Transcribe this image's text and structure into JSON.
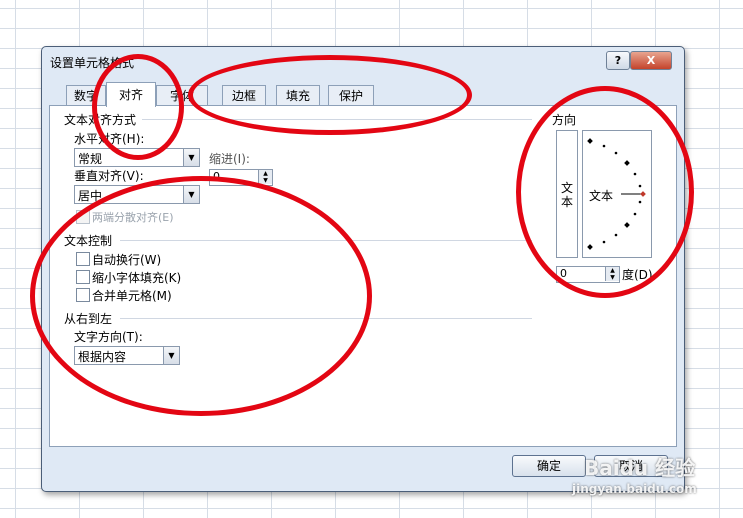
{
  "dialog": {
    "title": "设置单元格格式",
    "help": "?",
    "close": "X"
  },
  "tabs": [
    "数字",
    "对齐",
    "字体",
    "边框",
    "填充",
    "保护"
  ],
  "alignment": {
    "section_title": "文本对齐方式",
    "horizontal_label": "水平对齐(H):",
    "horizontal_value": "常规",
    "indent_label": "缩进(I):",
    "indent_value": "0",
    "vertical_label": "垂直对齐(V):",
    "vertical_value": "居中",
    "justify_distributed": "两端分散对齐(E)"
  },
  "text_control": {
    "section_title": "文本控制",
    "wrap": "自动换行(W)",
    "shrink": "缩小字体填充(K)",
    "merge": "合并单元格(M)"
  },
  "rtl": {
    "section_title": "从右到左",
    "direction_label": "文字方向(T):",
    "direction_value": "根据内容"
  },
  "orientation": {
    "section_title": "方向",
    "vertical_text": "文本",
    "horizontal_text": "文本",
    "degrees_value": "0",
    "degrees_label": "度(D)"
  },
  "buttons": {
    "ok": "确定",
    "cancel": "取消"
  },
  "watermark": {
    "brand": "Baidu 经验",
    "url": "jingyan.baidu.com"
  },
  "colors": {
    "annotation": "#e30613",
    "dialog_bg": "#dfe9f5"
  }
}
